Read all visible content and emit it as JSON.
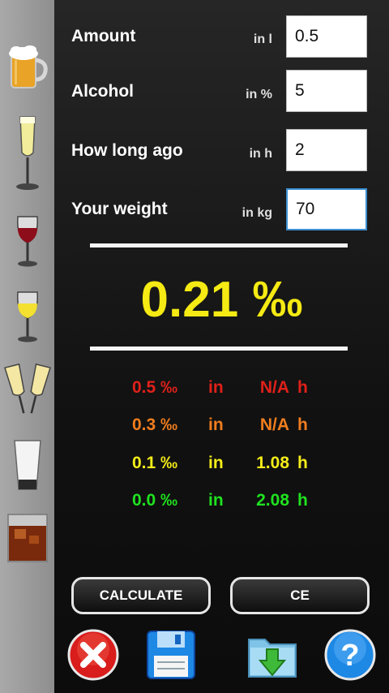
{
  "fields": [
    {
      "label": "Amount",
      "unit": "in l",
      "value": "0.5"
    },
    {
      "label": "Alcohol",
      "unit": "in %",
      "value": "5"
    },
    {
      "label": "How long ago",
      "unit": "in h",
      "value": "2"
    },
    {
      "label": "Your weight",
      "unit": "in kg",
      "value": "70"
    }
  ],
  "result": "0.21 ‰",
  "estimates": [
    {
      "level": "0.5 ‰",
      "in": "in",
      "time": "N/A",
      "unit": "h",
      "color": "#e0201a"
    },
    {
      "level": "0.3 ‰",
      "in": "in",
      "time": "N/A",
      "unit": "h",
      "color": "#f07d1e"
    },
    {
      "level": "0.1 ‰",
      "in": "in",
      "time": "1.08",
      "unit": "h",
      "color": "#f4ec19"
    },
    {
      "level": "0.0 ‰",
      "in": "in",
      "time": "2.08",
      "unit": "h",
      "color": "#1fe21f"
    }
  ],
  "buttons": {
    "calculate": "CALCULATE",
    "ce": "CE"
  },
  "drinks": [
    "beer-mug-icon",
    "champagne-flute-icon",
    "red-wine-glass-icon",
    "white-wine-glass-icon",
    "champagne-toast-icon",
    "shot-glass-icon",
    "whisky-glass-icon"
  ],
  "toolbar_icons": [
    "close-icon",
    "save-icon",
    "load-folder-icon",
    "help-icon"
  ],
  "colors": {
    "result": "#f5ea13",
    "focus": "#3b8fd1"
  }
}
